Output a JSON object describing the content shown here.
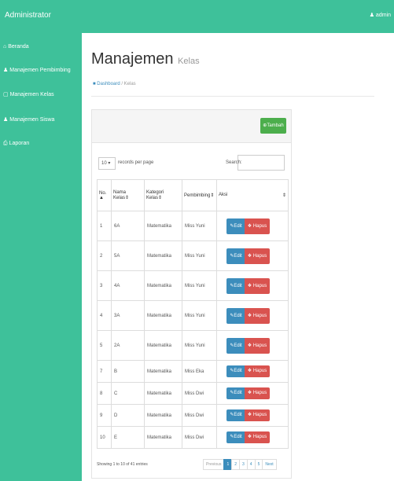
{
  "app": {
    "brand": "Administrator",
    "user": "admin"
  },
  "sidebar": {
    "items": [
      {
        "label": "Beranda",
        "icon": "home-icon"
      },
      {
        "label": "Manajemen Pembimbing",
        "icon": "user-icon"
      },
      {
        "label": "Manajemen Kelas",
        "icon": "list-icon"
      },
      {
        "label": "Manajemen Siswa",
        "icon": "users-icon"
      },
      {
        "label": "Laporan",
        "icon": "print-icon"
      }
    ]
  },
  "page": {
    "title": "Manajemen",
    "subtitle": "Kelas"
  },
  "breadcrumb": {
    "home": "Dashboard",
    "sep": "/",
    "current": "Kelas"
  },
  "panel": {
    "add_button": "Tambah",
    "length_value": "10",
    "length_label": "records per page",
    "search_label": "Search:",
    "search_value": ""
  },
  "table": {
    "headers": [
      "No.",
      "Nama Kelas",
      "Kategori Kelas",
      "Pembimbing",
      "Aksi"
    ],
    "edit_label": "Edit",
    "delete_label": "Hapus",
    "rows": [
      {
        "no": "1",
        "nama": "6A",
        "kategori": "Matematika",
        "pembimbing": "Miss Yuni"
      },
      {
        "no": "2",
        "nama": "5A",
        "kategori": "Matematika",
        "pembimbing": "Miss Yuni"
      },
      {
        "no": "3",
        "nama": "4A",
        "kategori": "Matematika",
        "pembimbing": "Miss Yuni"
      },
      {
        "no": "4",
        "nama": "3A",
        "kategori": "Matematika",
        "pembimbing": "Miss Yuni"
      },
      {
        "no": "5",
        "nama": "2A",
        "kategori": "Matematika",
        "pembimbing": "Miss Yuni"
      },
      {
        "no": "7",
        "nama": "B",
        "kategori": "Matematika",
        "pembimbing": "Miss Eka"
      },
      {
        "no": "8",
        "nama": "C",
        "kategori": "Matematika",
        "pembimbing": "Miss Dwi"
      },
      {
        "no": "9",
        "nama": "D",
        "kategori": "Matematika",
        "pembimbing": "Miss Dwi"
      },
      {
        "no": "10",
        "nama": "E",
        "kategori": "Matematika",
        "pembimbing": "Miss Dwi"
      }
    ]
  },
  "footer": {
    "info": "Showing 1 to 10 of 41 entries",
    "pages": [
      "Previous",
      "1",
      "2",
      "3",
      "4",
      "5",
      "Next"
    ],
    "active_page": "1"
  },
  "colors": {
    "brand": "#3ec19a",
    "primary": "#3c8dbc",
    "danger": "#d9534f",
    "success": "#4cae4c"
  }
}
